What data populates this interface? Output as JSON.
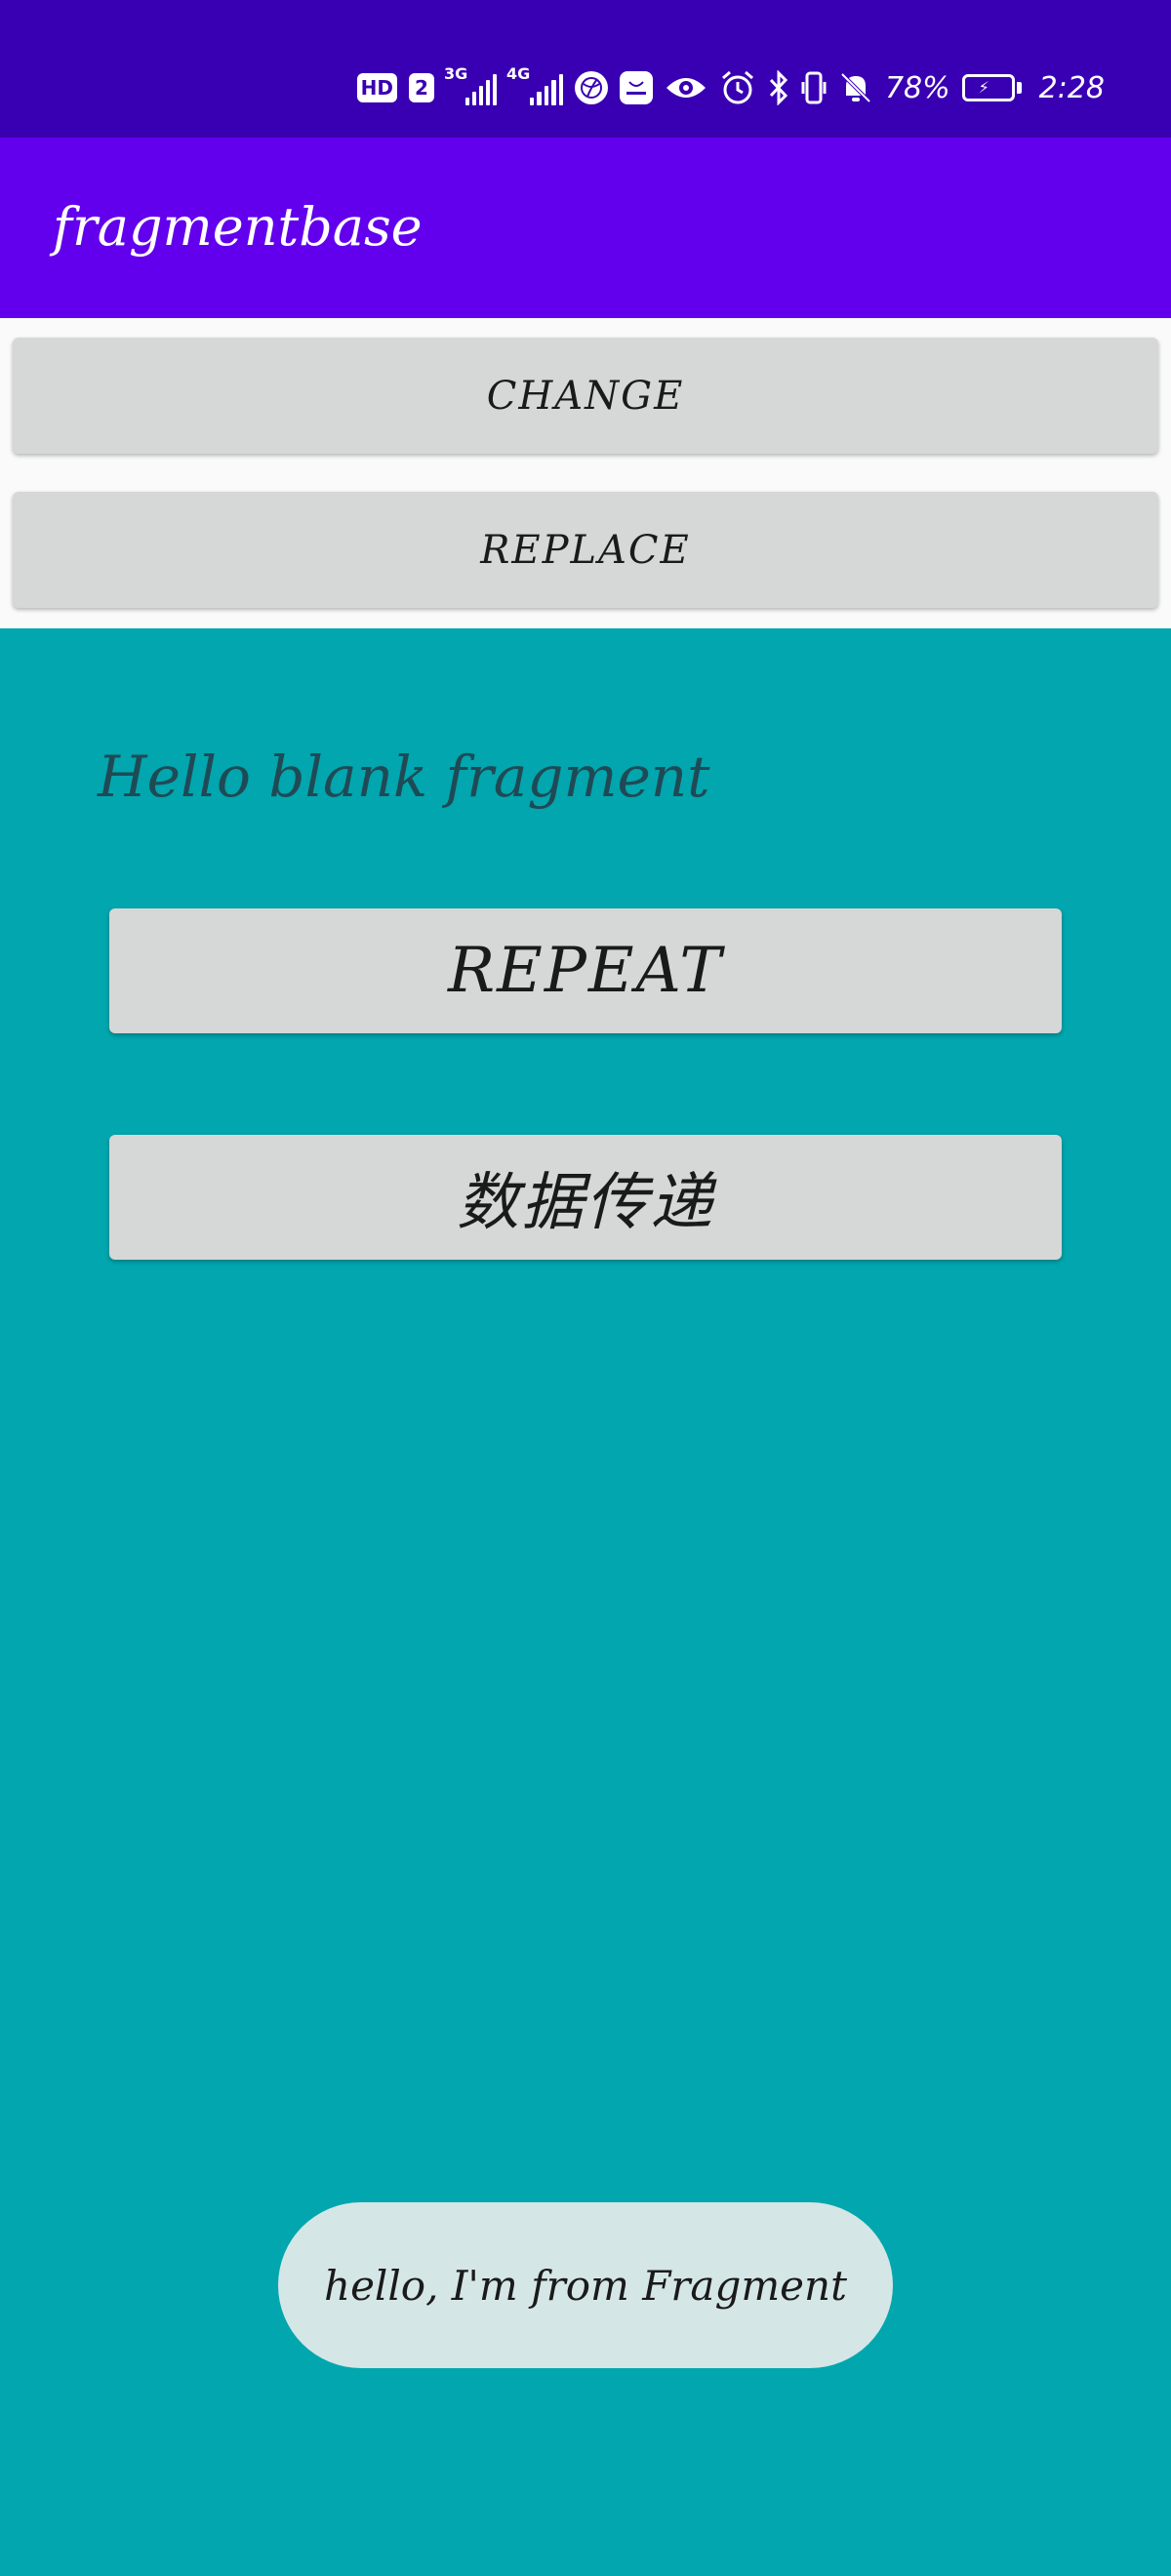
{
  "status_bar": {
    "hd_badge": "HD",
    "sim_badge": "2",
    "net1_label": "3G",
    "net2_label": "4G",
    "battery_percent": "78%",
    "time": "2:28",
    "icons": [
      "hd-icon",
      "sim2-icon",
      "signal-3g-icon",
      "signal-4g-icon",
      "ball-icon",
      "huawei-icon",
      "eye-icon",
      "alarm-icon",
      "bluetooth-icon",
      "vibrate-icon",
      "mute-bell-icon",
      "battery-charging-icon"
    ],
    "background": "#3900B3"
  },
  "app_bar": {
    "title": "fragmentbase",
    "background": "#6200EE"
  },
  "buttons": {
    "change_label": "CHANGE",
    "replace_label": "REPLACE"
  },
  "fragment": {
    "text": "Hello blank fragment",
    "repeat_label": "REPEAT",
    "pass_data_label": "数据传递",
    "background": "#01A6AE"
  },
  "toast": {
    "message": "hello, I'm from Fragment"
  }
}
